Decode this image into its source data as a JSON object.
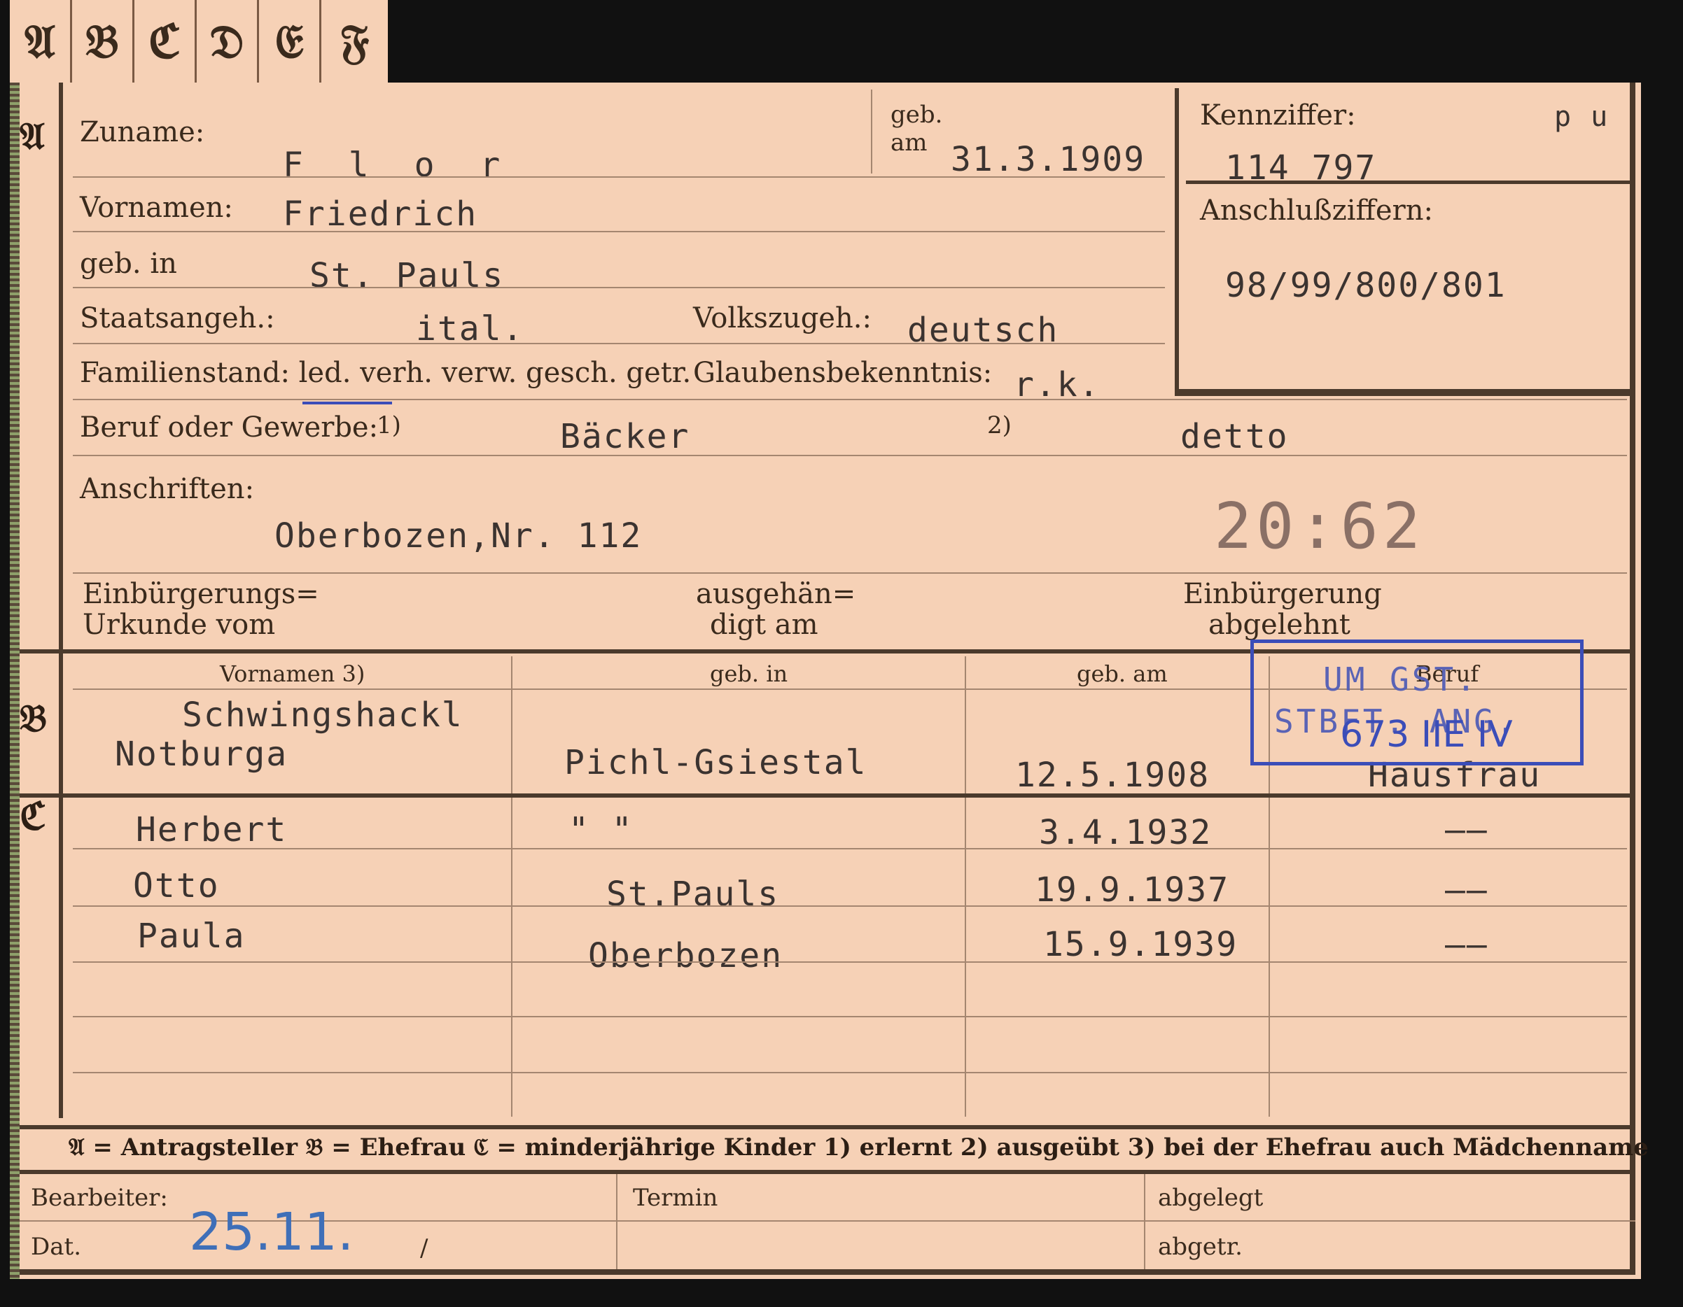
{
  "tabs": [
    "𝔄",
    "𝔅",
    "ℭ",
    "𝔇",
    "𝔈",
    "𝔉"
  ],
  "sections": {
    "a": "𝔄",
    "b": "𝔅",
    "c": "ℭ"
  },
  "applicant": {
    "surname_label": "Zuname:",
    "surname": "F l o r",
    "dob_label_1": "geb.",
    "dob_label_2": "am",
    "dob": "31.3.1909",
    "firstnames_label": "Vornamen:",
    "firstnames": "Friedrich",
    "birthplace_label": "geb. in",
    "birthplace": "St. Pauls",
    "citizenship_label": "Staatsangeh.:",
    "citizenship": "ital.",
    "ethnicity_label": "Volkszugeh.:",
    "ethnicity": "deutsch",
    "marital_label": "Familienstand: led. verh. verw. gesch. getr.",
    "religion_label": "Glaubensbekenntnis:",
    "religion": "r.k.",
    "profession_label": "Beruf oder Gewerbe:",
    "profession_note_1": "1)",
    "profession_1": "Bäcker",
    "profession_note_2": "2)",
    "profession_2": "detto",
    "address_label": "Anschriften:",
    "address": "Oberbozen,Nr. 112",
    "stamp_number": "20:62",
    "naturalization_label_1": "Einbürgerungs=",
    "naturalization_label_2": "Urkunde vom",
    "handed_label_1": "ausgehän=",
    "handed_label_2": "digt am",
    "refused_label_1": "Einbürgerung",
    "refused_label_2": "abgelehnt"
  },
  "id_box": {
    "label": "Kennziffer:",
    "value": "114 797",
    "mark": "p u",
    "connection_label": "Anschlußziffern:",
    "connection_value": "98/99/800/801"
  },
  "table_headers": [
    "Vornamen 3)",
    "geb. in",
    "geb. am",
    "Beruf"
  ],
  "wife": {
    "surname": "Schwingshackl",
    "firstname": "Notburga",
    "birthplace": "Pichl-Gsiestal",
    "dob": "12.5.1908",
    "profession": "Hausfrau"
  },
  "stamp": {
    "line1": "UM GST.",
    "line2": "STBFT. ANG.",
    "handwritten": "673 IIE IV"
  },
  "children": [
    {
      "name": "Herbert",
      "birthplace": "\"          \"",
      "dob": "3.4.1932",
      "profession": "——"
    },
    {
      "name": "Otto",
      "birthplace": "St.Pauls",
      "dob": "19.9.1937",
      "profession": "——"
    },
    {
      "name": "Paula",
      "birthplace": "Oberbozen",
      "dob": "15.9.1939",
      "profession": "——"
    }
  ],
  "legend": "𝔄 = Antragsteller   𝔅 = Ehefrau   ℭ = minderjährige Kinder   1) erlernt   2) ausgeübt   3) bei der Ehefrau auch Mädchenname",
  "footer": {
    "clerk_label": "Bearbeiter:",
    "date_label": "Dat.",
    "date_value": "25.11.",
    "slash": "/",
    "deadline_label": "Termin",
    "filed_label": "abgelegt",
    "shipped_label": "abgetr."
  }
}
